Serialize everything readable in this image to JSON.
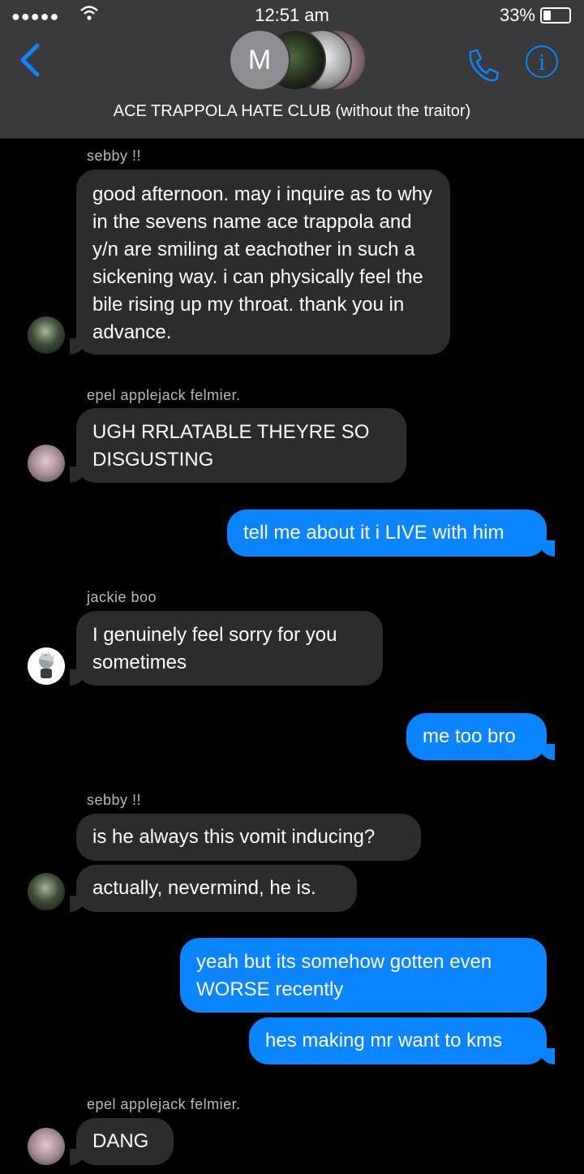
{
  "status_bar": {
    "signal": "●●●●●",
    "time": "12:51 am",
    "battery": "33%"
  },
  "header": {
    "title": "ACE TRAPPOLA HATE CLUB (without the traitor)",
    "avatar_initial": "M"
  },
  "messages": {
    "m1_sender": "sebby !!",
    "m1_text": "good afternoon. may i inquire as to why in the sevens name ace trappola and y/n are smiling at eachother in such a sickening way. i can physically feel the bile rising up my throat. thank you in advance.",
    "m2_sender": "epel applejack felmier.",
    "m2_text": "UGH RRLATABLE THEYRE SO DISGUSTING",
    "m3_text": "tell me about it i LIVE with him",
    "m4_sender": "jackie boo",
    "m4_text": "I genuinely feel sorry for you sometimes",
    "m5_text": "me too bro",
    "m6_sender": "sebby !!",
    "m6_text": "is he always this vomit inducing?",
    "m7_text": "actually, nevermind, he is.",
    "m8_text": "yeah but its somehow gotten even WORSE recently",
    "m9_text": "hes making mr want to kms",
    "m10_sender": "epel applejack felmier.",
    "m10_text": "DANG"
  },
  "colors": {
    "accent": "#0a84ff",
    "incoming": "#2c2c2e",
    "header": "#3a3a3c"
  }
}
